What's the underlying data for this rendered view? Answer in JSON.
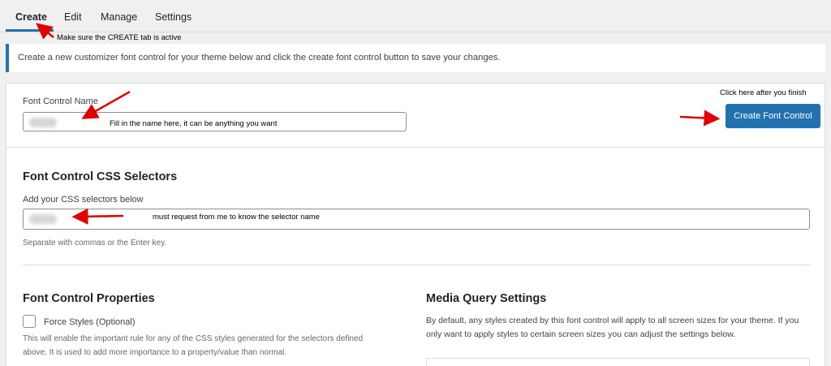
{
  "tabs": [
    {
      "label": "Create",
      "active": true
    },
    {
      "label": "Edit",
      "active": false
    },
    {
      "label": "Manage",
      "active": false
    },
    {
      "label": "Settings",
      "active": false
    }
  ],
  "notice": "Create a new customizer font control for your theme below and click the create font control button to save your changes.",
  "annotations": {
    "tab_note": "Make sure the CREATE tab is active",
    "button_note": "Click here after you finish",
    "name_note": "Fill in the name here, it can be anything you want",
    "selector_note": "must request from me to know the selector name"
  },
  "font_control_name": {
    "label": "Font Control Name"
  },
  "create_button": "Create Font Control",
  "css_selectors": {
    "heading": "Font Control CSS Selectors",
    "label": "Add your CSS selectors below",
    "help": "Separate with commas or the Enter key."
  },
  "properties": {
    "heading": "Font Control Properties",
    "force_styles_label": "Force Styles (Optional)",
    "force_styles_checked": false,
    "description": "This will enable the important rule for any of the CSS styles generated for the selectors defined above. It is used to add more importance to a property/value than normal."
  },
  "media_query": {
    "heading": "Media Query Settings",
    "description": "By default, any styles created by this font control will apply to all screen sizes for your theme. If you only want to apply styles to certain screen sizes you can adjust the settings below."
  },
  "colors": {
    "accent": "#2271b1",
    "annotation_arrow": "#e00000"
  }
}
